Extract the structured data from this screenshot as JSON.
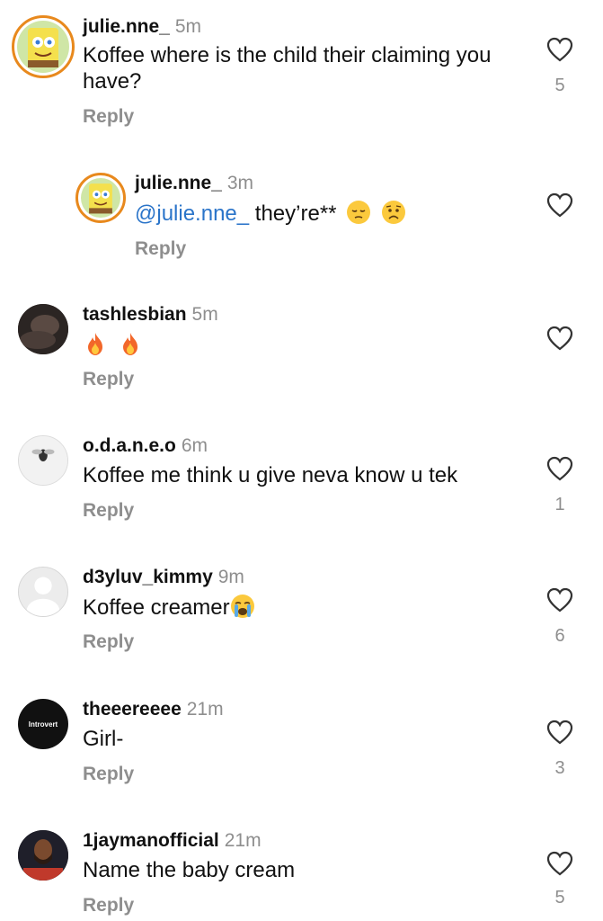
{
  "comments": [
    {
      "user": "julie.nne_",
      "time": "5m",
      "text": "Koffee where is the child their claiming you have?",
      "reply": "Reply",
      "likes": "5",
      "avatar_icon": "spongebob-avatar"
    },
    {
      "user": "julie.nne_",
      "time": "3m",
      "mention": "@julie.nne_",
      "text": " they’re**",
      "reply": "Reply",
      "likes": "",
      "avatar_icon": "spongebob-avatar",
      "emojis": [
        "pensive-face",
        "worried-face"
      ]
    },
    {
      "user": "tashlesbian",
      "time": "5m",
      "text": "",
      "reply": "Reply",
      "likes": "",
      "avatar_icon": "photo-avatar",
      "emojis": [
        "fire",
        "fire"
      ]
    },
    {
      "user": "o.d.a.n.e.o",
      "time": "6m",
      "text": "Koffee me think u give neva know u tek",
      "reply": "Reply",
      "likes": "1",
      "avatar_icon": "fly-avatar"
    },
    {
      "user": "d3yluv_kimmy",
      "time": "9m",
      "text": "Koffee creamer",
      "reply": "Reply",
      "likes": "6",
      "avatar_icon": "default-avatar",
      "emojis": [
        "crying-face"
      ]
    },
    {
      "user": "theeereeee",
      "time": "21m",
      "text": "Girl-",
      "reply": "Reply",
      "likes": "3",
      "avatar_icon": "introvert-avatar",
      "avatar_text": "Introvert"
    },
    {
      "user": "1jaymanofficial",
      "time": "21m",
      "text": "Name the baby cream",
      "reply": "Reply",
      "likes": "5",
      "avatar_icon": "man-avatar"
    }
  ],
  "colors": {
    "mention": "#2a74c9",
    "muted": "#8e8e8e",
    "ring": "#d62976"
  }
}
